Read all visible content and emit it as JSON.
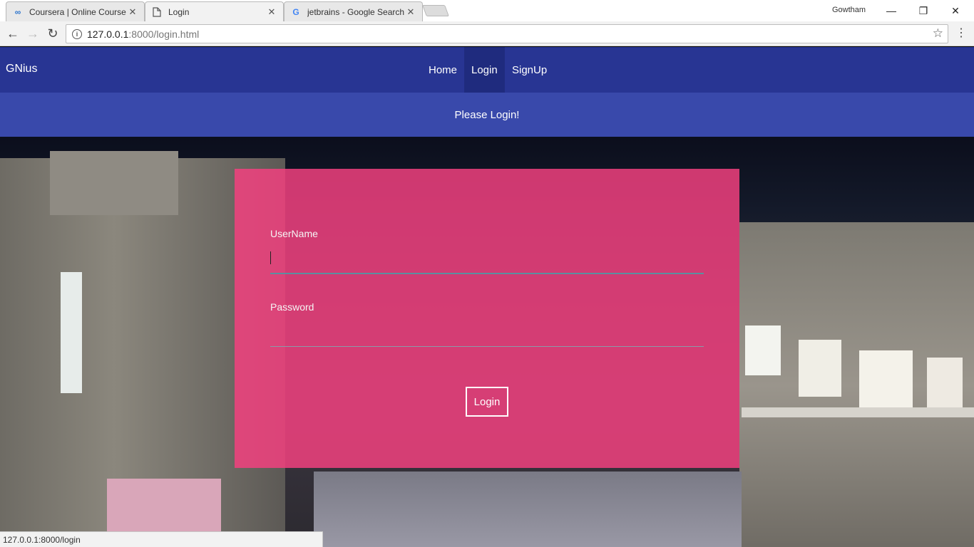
{
  "browser": {
    "tabs": [
      {
        "title": "Coursera | Online Course",
        "icon": "coursera-icon"
      },
      {
        "title": "Login",
        "icon": "page-icon"
      },
      {
        "title": "jetbrains - Google Search",
        "icon": "google-icon"
      }
    ],
    "profile": "Gowtham",
    "url_host": "127.0.0.1",
    "url_path": ":8000/login.html",
    "status_url": "127.0.0.1:8000/login"
  },
  "nav": {
    "brand": "GNius",
    "links": [
      "Home",
      "Login",
      "SignUp"
    ],
    "active_link": "Login"
  },
  "banner": {
    "text": "Please Login!"
  },
  "form": {
    "username_label": "UserName",
    "username_value": "",
    "password_label": "Password",
    "password_value": "",
    "submit_label": "Login"
  },
  "colors": {
    "navbar": "#283593",
    "banner": "#3949ab",
    "card": "#f44080",
    "field_underline": "#5b8fa0"
  }
}
